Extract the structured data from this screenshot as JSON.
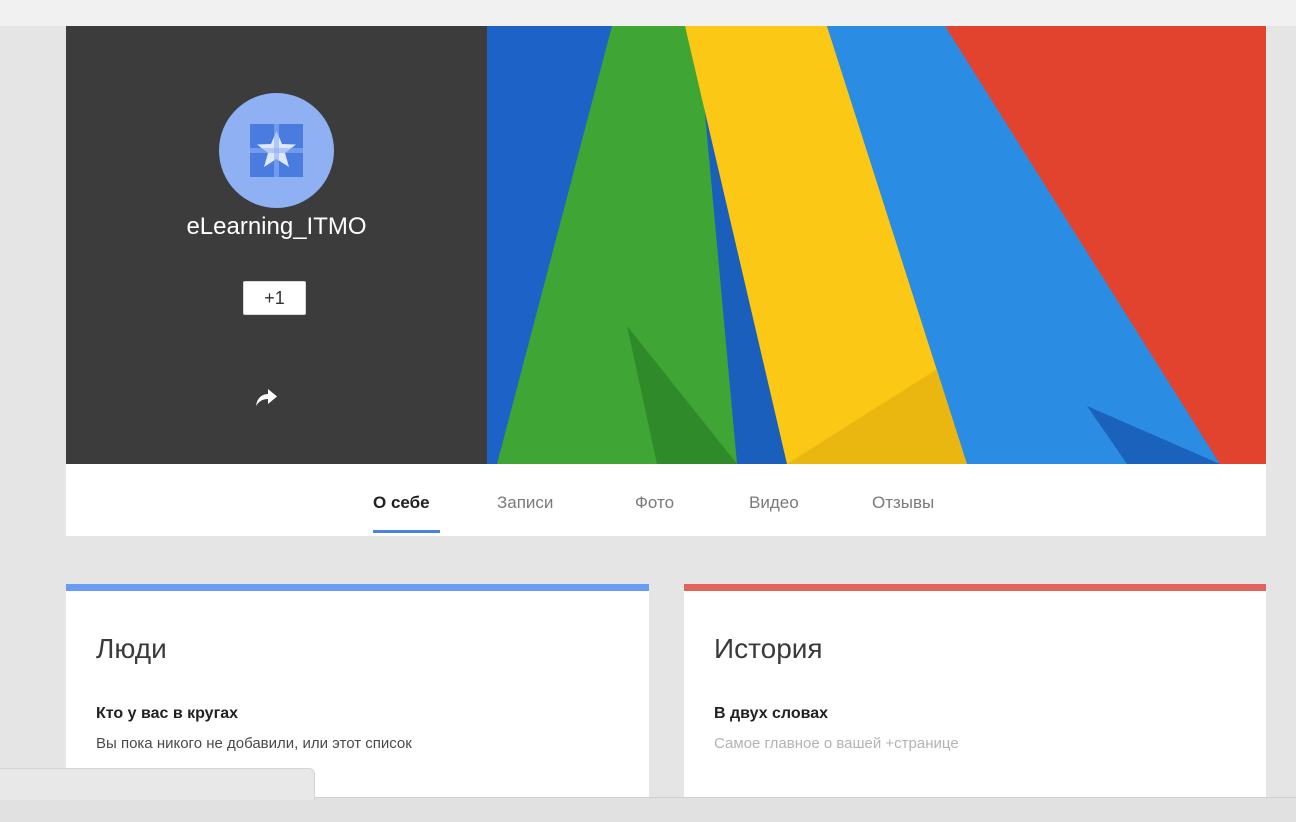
{
  "profile": {
    "name": "eLearning_ITMO",
    "plus_one_label": "+1",
    "avatar_icon": "page-logo-icon",
    "share_icon": "share-arrow-icon"
  },
  "tabs": [
    {
      "label": "О себе",
      "active": true
    },
    {
      "label": "Записи",
      "active": false
    },
    {
      "label": "Фото",
      "active": false
    },
    {
      "label": "Видео",
      "active": false
    },
    {
      "label": "Отзывы",
      "active": false
    }
  ],
  "people_card": {
    "title": "Люди",
    "subtitle": "Кто у вас в кругах",
    "text": "Вы пока никого не добавили, или этот список",
    "accent": "#6a9cf1"
  },
  "story_card": {
    "title": "История",
    "subtitle": "В двух словах",
    "placeholder": "Самое главное о вашей +странице",
    "accent": "#e3635a"
  },
  "colors": {
    "identity_bg": "#3c3c3c",
    "avatar_bg": "#8fb1f4",
    "tab_active_underline": "#4a82e0",
    "cover_blue": "#1f6fcf",
    "cover_green": "#3fa535",
    "cover_yellow": "#fbc815",
    "cover_red": "#e2432f"
  }
}
